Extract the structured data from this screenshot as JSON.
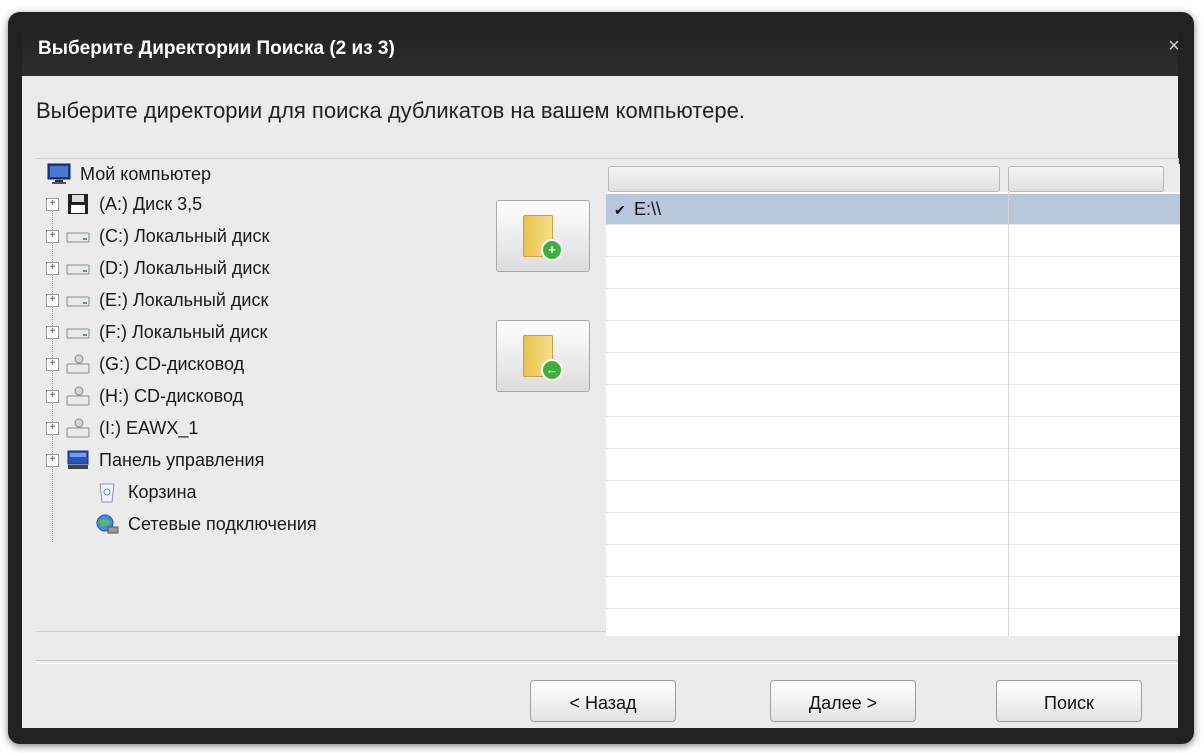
{
  "window": {
    "title": "Выберите Директории Поиска (2 из 3)",
    "close_glyph": "×"
  },
  "instruction": "Выберите директории для поиска дубликатов на вашем компьютере.",
  "tree": {
    "root": {
      "label": "Мой компьютер",
      "icon": "computer-icon"
    },
    "items": [
      {
        "label": "(A:) Диск 3,5",
        "icon": "floppy-disk-icon",
        "expandable": true
      },
      {
        "label": "(C:) Локальный диск",
        "icon": "hard-drive-icon",
        "expandable": true
      },
      {
        "label": "(D:) Локальный диск",
        "icon": "hard-drive-icon",
        "expandable": true
      },
      {
        "label": "(E:) Локальный диск",
        "icon": "hard-drive-icon",
        "expandable": true
      },
      {
        "label": "(F:) Локальный диск",
        "icon": "hard-drive-icon",
        "expandable": true
      },
      {
        "label": "(G:) CD-дисковод",
        "icon": "cd-drive-icon",
        "expandable": true
      },
      {
        "label": "(H:) CD-дисковод",
        "icon": "cd-drive-icon",
        "expandable": true
      },
      {
        "label": "(I:) EAWX_1",
        "icon": "cd-drive-icon",
        "expandable": true
      },
      {
        "label": "Панель управления",
        "icon": "control-panel-icon",
        "expandable": true
      },
      {
        "label": "Корзина",
        "icon": "recycle-bin-icon",
        "expandable": false
      },
      {
        "label": "Сетевые подключения",
        "icon": "network-icon",
        "expandable": false
      }
    ]
  },
  "actions": {
    "add_icon": "add-folder-icon",
    "remove_icon": "remove-folder-icon"
  },
  "list": {
    "rows": [
      {
        "checked": true,
        "check_glyph": "✔",
        "path": "E:\\\\"
      }
    ]
  },
  "footer": {
    "back_label": "< Назад",
    "next_label": "Далее >",
    "search_label": "Поиск"
  },
  "colors": {
    "title_bar": "#222222",
    "selection": "#b9c7dc",
    "client_bg": "#ebebeb"
  }
}
